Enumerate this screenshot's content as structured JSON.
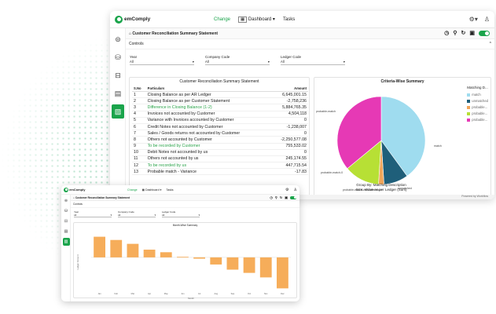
{
  "brand": "emComply",
  "nav": {
    "change": "Change",
    "dashboard": "Dashboard",
    "tasks": "Tasks"
  },
  "breadcrumb": "Customer Reconciliation Summary Statement",
  "controls_label": "Controls",
  "filters": [
    {
      "label": "Year",
      "value": "All"
    },
    {
      "label": "Company Code",
      "value": "All"
    },
    {
      "label": "Ledger Code",
      "value": "All"
    }
  ],
  "table": {
    "title": "Customer Reconciliation Summary Statement",
    "headers": {
      "sno": "S.No",
      "particulars": "Particulars",
      "amount": "Amount"
    },
    "rows": [
      {
        "sno": "1",
        "particulars": "Closing Balance as per AR Ledger",
        "amount": "6,645,001.15",
        "green": false
      },
      {
        "sno": "2",
        "particulars": "Closing Balance as per Customer Statement",
        "amount": "-2,758,236",
        "green": false
      },
      {
        "sno": "3",
        "particulars": "Difference in Closing Balance (1-2)",
        "amount": "5,884,765.35",
        "green": true
      },
      {
        "sno": "4",
        "particulars": "Invoices not accounted by Customer",
        "amount": "4,504,118",
        "green": false
      },
      {
        "sno": "5",
        "particulars": "Variance with Invoices accounted by Customer",
        "amount": "0",
        "green": false
      },
      {
        "sno": "6",
        "particulars": "Credit Notes not accounted by Customer",
        "amount": "-1,238,007",
        "green": false
      },
      {
        "sno": "7",
        "particulars": "Sales / Goods returns not accounted by Customer",
        "amount": "0",
        "green": false
      },
      {
        "sno": "8",
        "particulars": "Others not accounted by Customer",
        "amount": "-2,250,577.08",
        "green": false
      },
      {
        "sno": "9",
        "particulars": "To be recorded by Customer",
        "amount": "755,533.02",
        "green": true
      },
      {
        "sno": "10",
        "particulars": "Debit Notes not accounted by us",
        "amount": "0",
        "green": false
      },
      {
        "sno": "11",
        "particulars": "Others not accounted by us",
        "amount": "245,174.55",
        "green": false
      },
      {
        "sno": "12",
        "particulars": "To be recorded by us",
        "amount": "447,715.54",
        "green": true
      },
      {
        "sno": "13",
        "particulars": "Probable match - Variance",
        "amount": "-17.83",
        "green": false
      }
    ]
  },
  "pie": {
    "title": "Criteria-Wise Summary",
    "caption_line1": "Group By: Matching Description",
    "caption_line2": "Size: Value as per Ledger (Sum)",
    "legend_title": "Matching D...",
    "slice_labels": {
      "match": "match",
      "probable": "probable-match",
      "probable2": "probable-match-0",
      "pmd": "probable-match-with-difference",
      "unmatched": "unmatched"
    }
  },
  "chart_data": [
    {
      "type": "pie",
      "title": "Criteria-Wise Summary",
      "slices": [
        {
          "name": "match",
          "value": 40,
          "color": "#9fdcef"
        },
        {
          "name": "unmatched",
          "value": 9,
          "color": "#1f5f7a"
        },
        {
          "name": "probable-match-with-difference",
          "value": 2,
          "color": "#f2a65a"
        },
        {
          "name": "probable-match-0",
          "value": 13,
          "color": "#b7e035"
        },
        {
          "name": "probable-match",
          "value": 36,
          "color": "#e639b5"
        }
      ],
      "legend": [
        "match",
        "unmatched",
        "probable...",
        "probable...",
        "probable..."
      ]
    },
    {
      "type": "bar",
      "title": "Month-Wise Summary",
      "ylabel": "Ledger Amount",
      "xlabel": "Month",
      "categories": [
        "Jan",
        "Feb",
        "Mar",
        "Apr",
        "May",
        "Jun",
        "Jul",
        "Aug",
        "Sep",
        "Oct",
        "Nov",
        "Dec"
      ],
      "values": [
        3.2,
        2.7,
        2.1,
        1.2,
        0.8,
        0.1,
        -0.2,
        -1.1,
        -1.9,
        -2.4,
        -3.1,
        -4.8
      ],
      "color": "#f6ad5a"
    }
  ],
  "bottom_note": "Powered by Workflow"
}
